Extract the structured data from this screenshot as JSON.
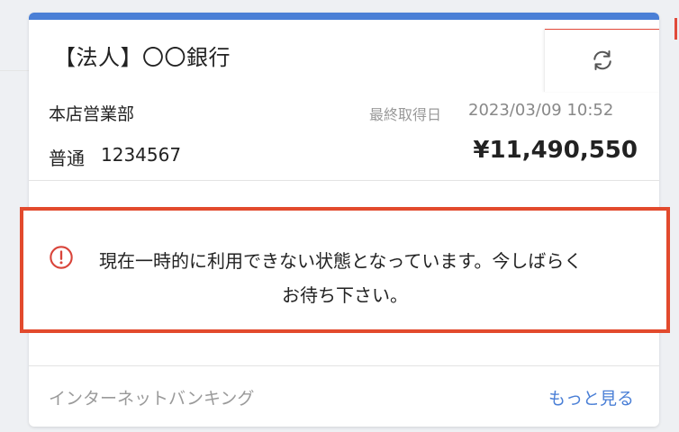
{
  "card": {
    "title": "【法人】〇〇銀行",
    "branch": "本店営業部",
    "last_fetched_label": "最終取得日",
    "last_fetched_value": "2023/03/09 10:52",
    "account_type": "普通",
    "account_number": "1234567",
    "balance": "¥11,490,550",
    "refresh_icon": "refresh-icon"
  },
  "alert": {
    "icon": "warning-circle-icon",
    "line1": "現在一時的に利用できない状態となっています。今しばらく",
    "line2": "お待ち下さい。"
  },
  "footer": {
    "left_label": "インターネットバンキング",
    "more_link": "もっと見る"
  },
  "colors": {
    "accent_blue": "#4a7fd6",
    "alert_red": "#e24a2d",
    "muted_text": "#999999"
  }
}
